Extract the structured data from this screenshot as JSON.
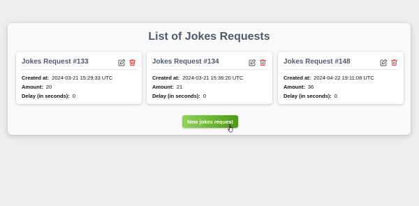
{
  "page": {
    "title": "List of Jokes Requests"
  },
  "labels": {
    "created_at": "Created at:",
    "amount": "Amount:",
    "delay": "Delay (in seconds):"
  },
  "requests": [
    {
      "title": "Jokes Request #133",
      "created_at": "2024-03-21 15:29:33 UTC",
      "amount": "20",
      "delay": "0"
    },
    {
      "title": "Jokes Request #134",
      "created_at": "2024-03-21 15:36:20 UTC",
      "amount": "21",
      "delay": "0"
    },
    {
      "title": "Jokes Request #148",
      "created_at": "2024-04-22 19:11:08 UTC",
      "amount": "36",
      "delay": "0"
    }
  ],
  "actions": {
    "new_request": "New jokes request"
  },
  "icons": {
    "edit": "pencil-square-icon",
    "delete": "trash-icon",
    "cursor": "hand-pointer-icon"
  },
  "colors": {
    "title": "#4e5a6e",
    "delete_icon": "#e53935",
    "edit_icon": "#555555",
    "button_gradient_start": "#8fd456",
    "button_gradient_end": "#4e9a14"
  }
}
